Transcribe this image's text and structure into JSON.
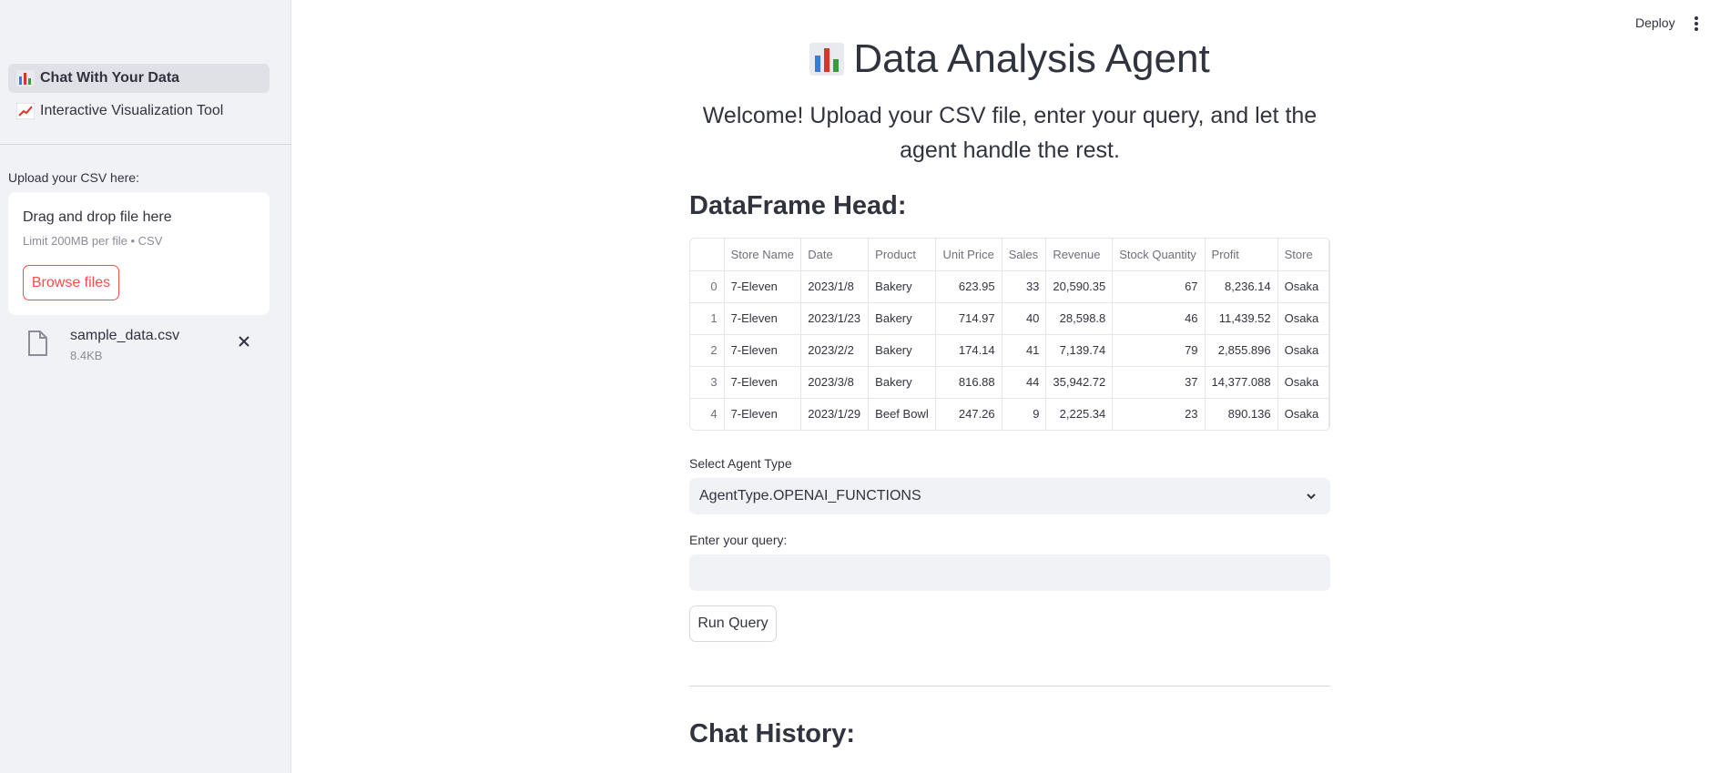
{
  "sidebar": {
    "nav_items": [
      {
        "label": "Chat With Your Data",
        "icon": "bar-chart-emoji",
        "active": true
      },
      {
        "label": "Interactive Visualization Tool",
        "icon": "line-chart-emoji",
        "active": false
      }
    ],
    "upload_label": "Upload your CSV here:",
    "dropzone": {
      "title": "Drag and drop file here",
      "limit": "Limit 200MB per file • CSV",
      "browse_label": "Browse files"
    },
    "file": {
      "name": "sample_data.csv",
      "size": "8.4KB"
    }
  },
  "header": {
    "deploy_label": "Deploy"
  },
  "main": {
    "title": "Data Analysis Agent",
    "welcome": "Welcome! Upload your CSV file, enter your query, and let the agent handle the rest.",
    "dataframe_heading": "DataFrame Head:",
    "table": {
      "columns": [
        "",
        "Store Name",
        "Date",
        "Product",
        "Unit Price",
        "Sales",
        "Revenue",
        "Stock Quantity",
        "Profit",
        "Store"
      ],
      "rows": [
        [
          "0",
          "7-Eleven",
          "2023/1/8",
          "Bakery",
          "623.95",
          "33",
          "20,590.35",
          "67",
          "8,236.14",
          "Osaka"
        ],
        [
          "1",
          "7-Eleven",
          "2023/1/23",
          "Bakery",
          "714.97",
          "40",
          "28,598.8",
          "46",
          "11,439.52",
          "Osaka"
        ],
        [
          "2",
          "7-Eleven",
          "2023/2/2",
          "Bakery",
          "174.14",
          "41",
          "7,139.74",
          "79",
          "2,855.896",
          "Osaka"
        ],
        [
          "3",
          "7-Eleven",
          "2023/3/8",
          "Bakery",
          "816.88",
          "44",
          "35,942.72",
          "37",
          "14,377.088",
          "Osaka"
        ],
        [
          "4",
          "7-Eleven",
          "2023/1/29",
          "Beef Bowl",
          "247.26",
          "9",
          "2,225.34",
          "23",
          "890.136",
          "Osaka"
        ]
      ]
    },
    "agent_type_label": "Select Agent Type",
    "agent_type_value": "AgentType.OPENAI_FUNCTIONS",
    "query_label": "Enter your query:",
    "query_value": "",
    "run_label": "Run Query",
    "chat_history_heading": "Chat History:"
  },
  "colors": {
    "accent": "#ff4b4b",
    "sidebar_bg": "#f0f2f6",
    "text": "#31333f"
  }
}
